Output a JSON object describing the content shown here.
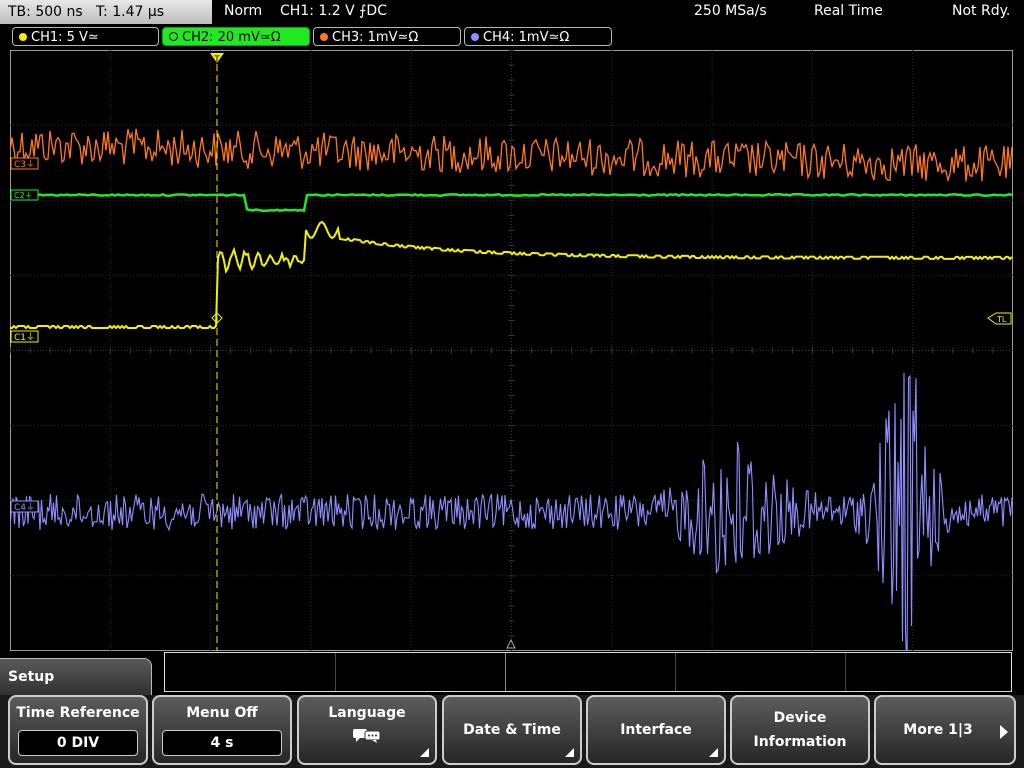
{
  "status": {
    "timebase": "TB: 500 ns",
    "trigger_time": "T: 1.47 µs",
    "trigger_mode": "Norm",
    "trigger_info": "CH1: 1.2 V ⨍DC",
    "sample_rate": "250 MSa/s",
    "acq_mode": "Real Time",
    "ready_state": "Not Rdy."
  },
  "channels": [
    {
      "label": "CH1: 5 V≃",
      "color": "#f2f200"
    },
    {
      "label": "CH2: 20 mV≃Ω",
      "color": "#22e822"
    },
    {
      "label": "CH3: 1mV≃Ω",
      "color": "#ff7a1e"
    },
    {
      "label": "CH4: 1mV≃Ω",
      "color": "#8f8fff"
    }
  ],
  "markers": {
    "c3": "C3⏚",
    "c2": "C2⏚",
    "c1": "C1⏚",
    "c4": "C4⏚",
    "trigger_level": "TL",
    "trigger_position": "T"
  },
  "menu": {
    "title": "Setup",
    "softkeys": {
      "time_reference": {
        "label": "Time Reference",
        "value": "0 DIV"
      },
      "menu_off": {
        "label": "Menu Off",
        "value": "4 s"
      },
      "language": {
        "label": "Language",
        "icon": "speech-bubbles-icon"
      },
      "date_time": {
        "label": "Date & Time"
      },
      "interface": {
        "label": "Interface"
      },
      "device_info": {
        "label1": "Device",
        "label2": "Information"
      },
      "more": {
        "label": "More 1|3"
      }
    }
  }
}
